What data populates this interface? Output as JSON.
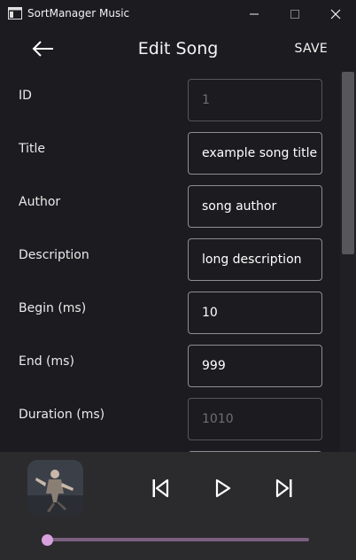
{
  "window": {
    "title": "SortManager Music",
    "controls": {
      "minimize": "—",
      "maximize": "☐",
      "close": "✕"
    }
  },
  "appbar": {
    "back_icon": "arrow-left-icon",
    "title": "Edit Song",
    "save_label": "SAVE"
  },
  "form": {
    "fields": [
      {
        "label": "ID",
        "value": "1",
        "disabled": true
      },
      {
        "label": "Title",
        "value": "example song title",
        "disabled": false
      },
      {
        "label": "Author",
        "value": "song author",
        "disabled": false
      },
      {
        "label": "Description",
        "value": "long description",
        "disabled": false
      },
      {
        "label": "Begin (ms)",
        "value": "10",
        "disabled": false
      },
      {
        "label": "End (ms)",
        "value": "999",
        "disabled": false
      },
      {
        "label": "Duration (ms)",
        "value": "1010",
        "disabled": true
      }
    ]
  },
  "player": {
    "album_art_icon": "album-art",
    "prev_icon": "skip-previous-icon",
    "play_icon": "play-icon",
    "next_icon": "skip-next-icon",
    "progress": 0.0
  },
  "colors": {
    "background": "#1c1b1f",
    "player_bg": "#2b2b2e",
    "accent": "#d8a0dc",
    "track": "#7b5f80",
    "field_border": "#8e8e93"
  }
}
